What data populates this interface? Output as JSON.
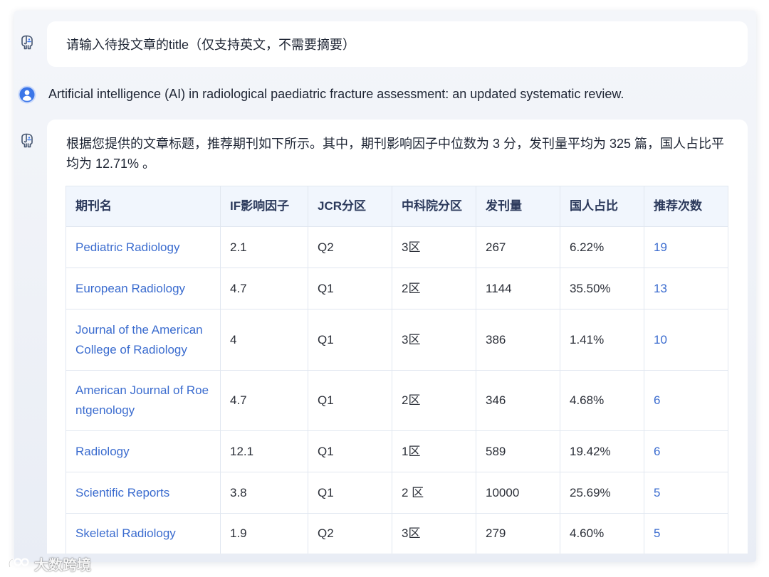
{
  "colors": {
    "accent_link": "#3b6ccf",
    "table_header_bg": "#f1f6fd",
    "bubble_bg": "#ffffff",
    "avatar_blue": "#3b76e8",
    "text_primary": "#1d2433"
  },
  "icons": {
    "bot": "elephant-bot-icon",
    "user": "user-avatar-icon",
    "watermark_logo": "watermark-logo-icon"
  },
  "conversation": {
    "bot_prompt": "请输入待投文章的title（仅支持英文，不需要摘要）",
    "user_message": "Artificial intelligence (AI) in radiological paediatric fracture assessment: an updated systematic review.",
    "bot_reply": "根据您提供的文章标题，推荐期刊如下所示。其中，期刊影响因子中位数为 3 分，发刊量平均为 325 篇，国人占比平均为 12.71% 。"
  },
  "journal_table": {
    "columns": [
      "期刊名",
      "IF影响因子",
      "JCR分区",
      "中科院分区",
      "发刊量",
      "国人占比",
      "推荐次数"
    ],
    "rows": [
      {
        "name": "Pediatric Radiology",
        "impact_factor": "2.1",
        "jcr": "Q2",
        "cas": "3区",
        "volume": "267",
        "china_share": "6.22%",
        "recommend_count": "19"
      },
      {
        "name": "European Radiology",
        "impact_factor": "4.7",
        "jcr": "Q1",
        "cas": "2区",
        "volume": "1144",
        "china_share": "35.50%",
        "recommend_count": "13"
      },
      {
        "name": "Journal of the American College of Radiology",
        "impact_factor": "4",
        "jcr": "Q1",
        "cas": "3区",
        "volume": "386",
        "china_share": "1.41%",
        "recommend_count": "10"
      },
      {
        "name": "American Journal of Roentgenology",
        "impact_factor": "4.7",
        "jcr": "Q1",
        "cas": "2区",
        "volume": "346",
        "china_share": "4.68%",
        "recommend_count": "6"
      },
      {
        "name": "Radiology",
        "impact_factor": "12.1",
        "jcr": "Q1",
        "cas": "1区",
        "volume": "589",
        "china_share": "19.42%",
        "recommend_count": "6"
      },
      {
        "name": "Scientific Reports",
        "impact_factor": "3.8",
        "jcr": "Q1",
        "cas": "2 区",
        "volume": "10000",
        "china_share": "25.69%",
        "recommend_count": "5"
      },
      {
        "name": "Skeletal Radiology",
        "impact_factor": "1.9",
        "jcr": "Q2",
        "cas": "3区",
        "volume": "279",
        "china_share": "4.60%",
        "recommend_count": "5"
      }
    ]
  },
  "watermark": {
    "text": "大数跨境"
  }
}
